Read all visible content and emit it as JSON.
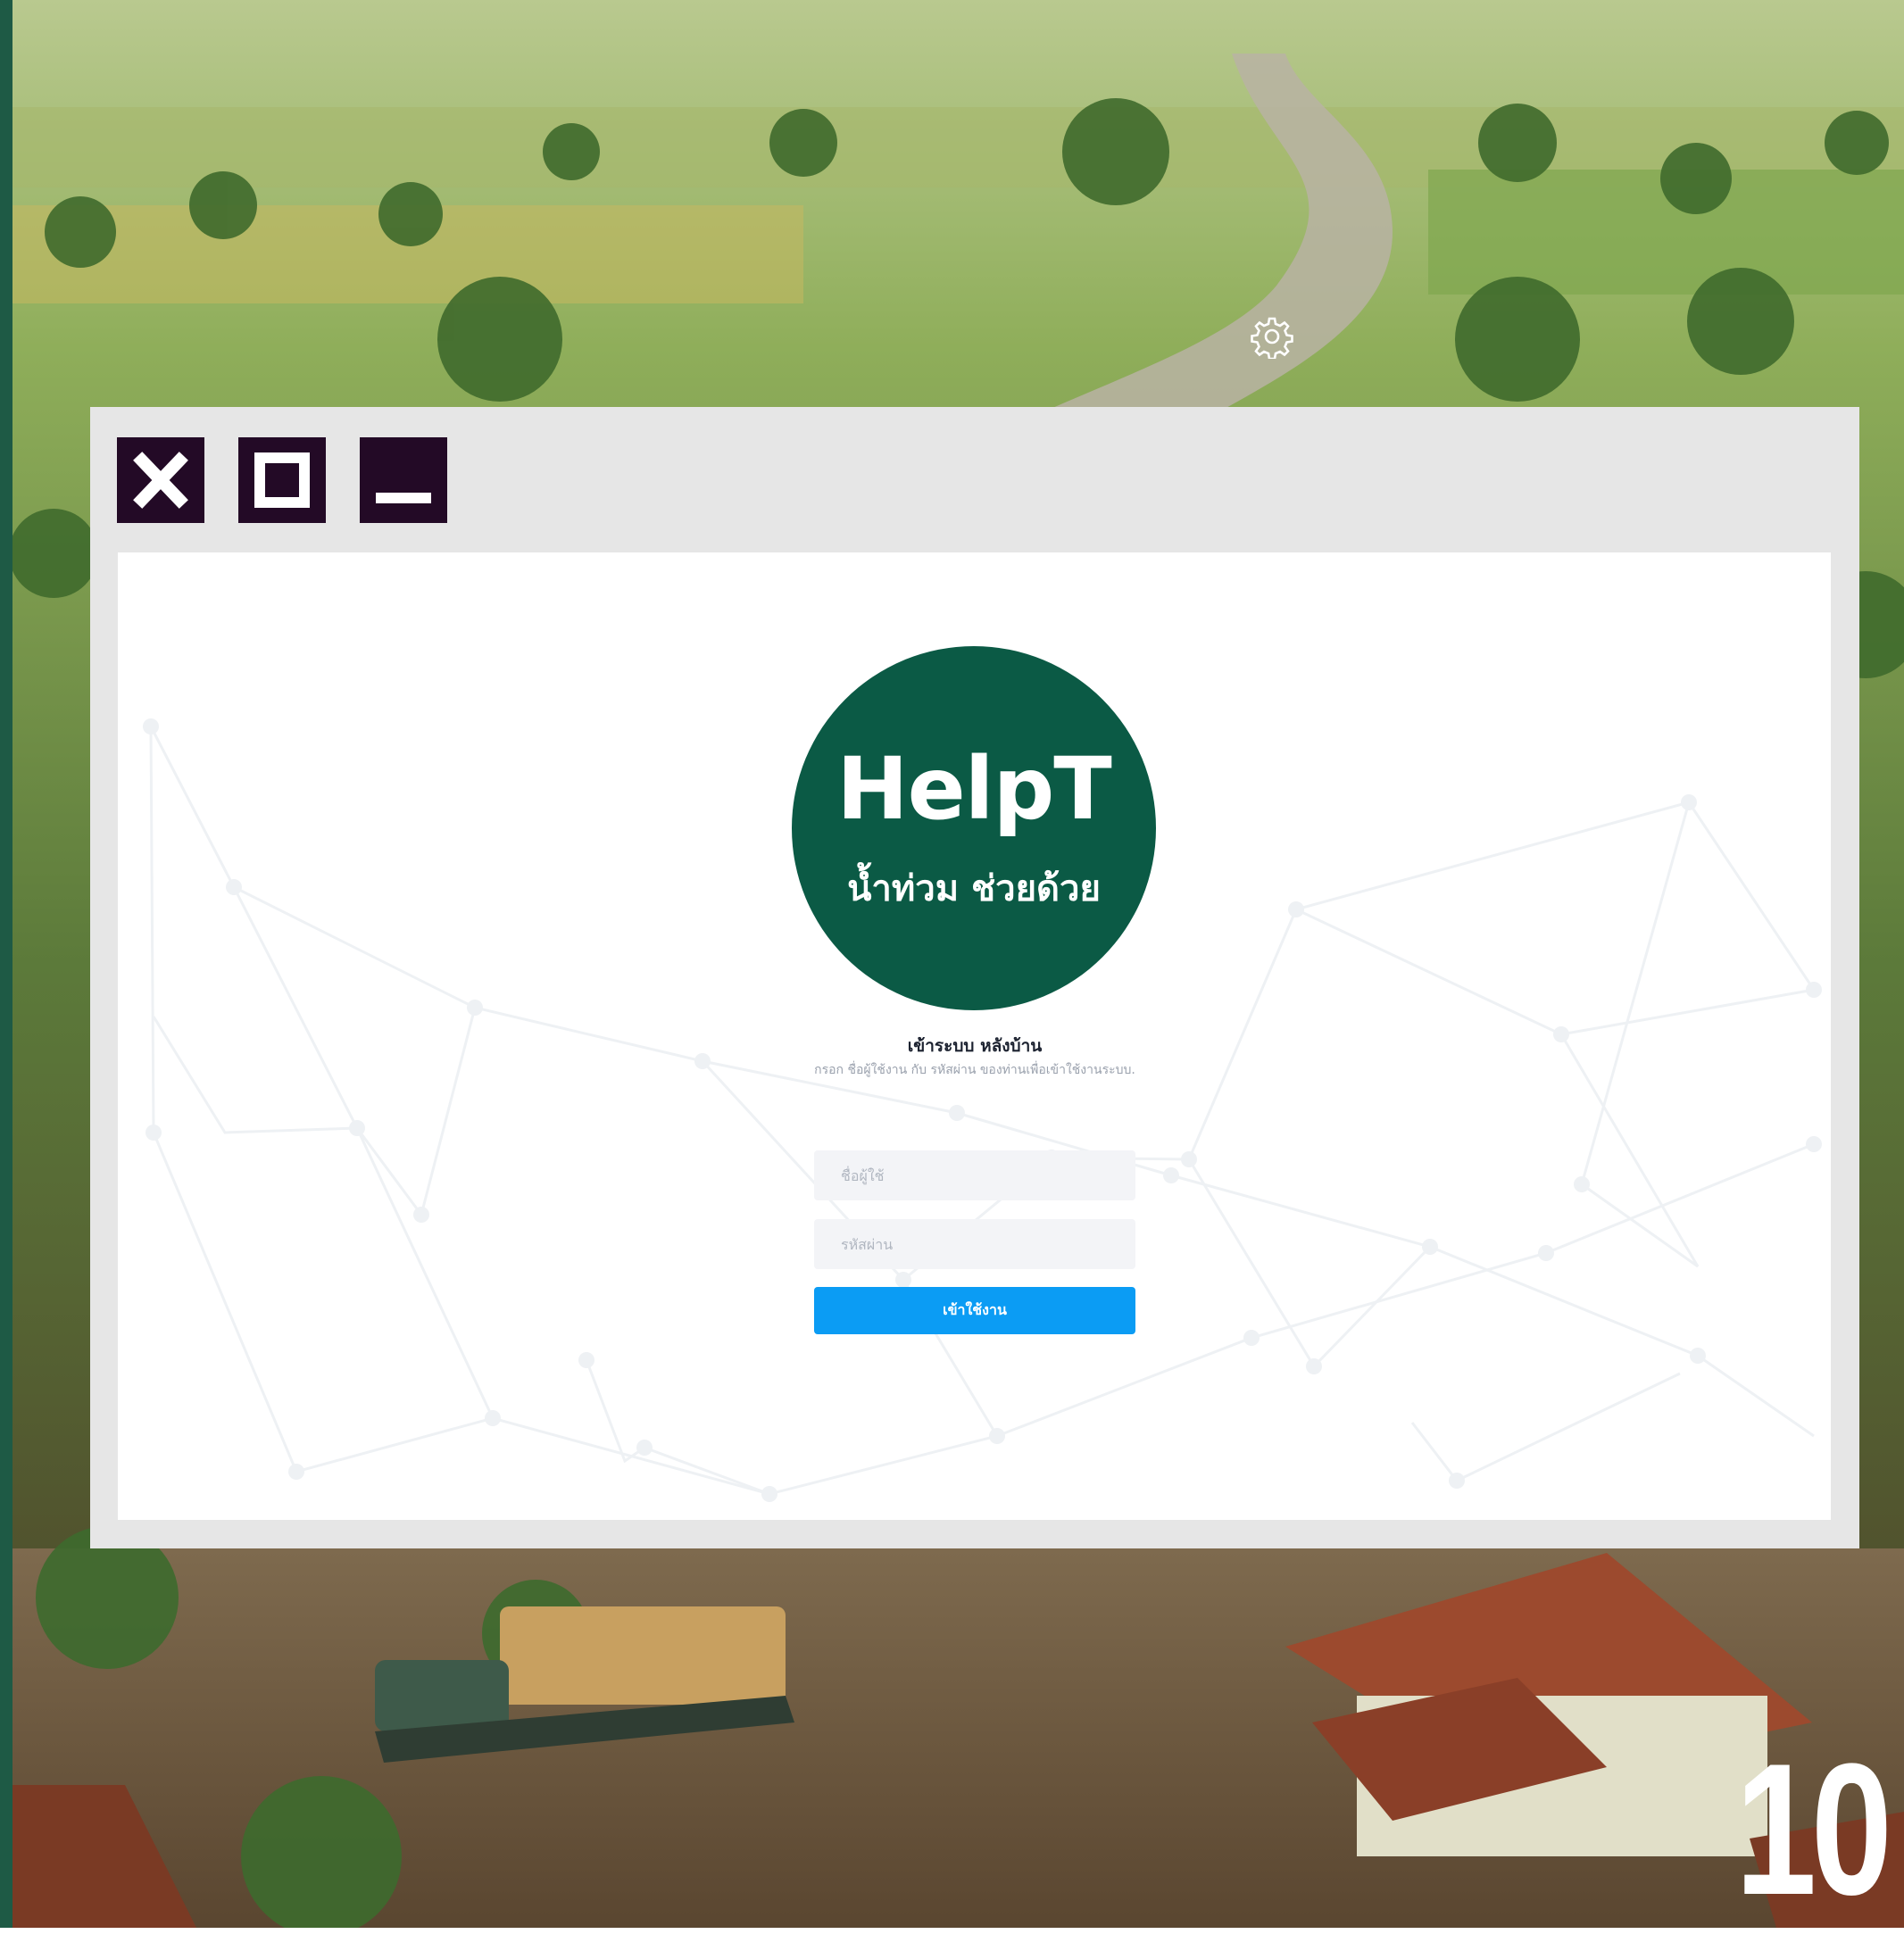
{
  "window": {
    "controls": {
      "close_label": "close",
      "maximize_label": "maximize",
      "minimize_label": "minimize"
    }
  },
  "logo": {
    "title": "HelpT",
    "subtitle": "น้ำท่วม ช่วยด้วย"
  },
  "login": {
    "title": "เข้าระบบ หลังบ้าน",
    "hint": "กรอก ชื่อผู้ใช้งาน กับ รหัสผ่าน ของท่านเพื่อเข้าใช้งานระบบ.",
    "username_placeholder": "ชื่อผู้ใช้",
    "password_placeholder": "รหัสผ่าน",
    "submit_label": "เข้าใช้งาน"
  },
  "page_number": "10",
  "icons": {
    "settings": "gear-icon",
    "close": "close-icon",
    "maximize": "maximize-icon",
    "minimize": "minimize-icon"
  },
  "colors": {
    "brand_green": "#0b5a45",
    "button_blue": "#0b9cf4",
    "window_chrome": "#e6e6e6",
    "control_dark": "#230a26"
  }
}
